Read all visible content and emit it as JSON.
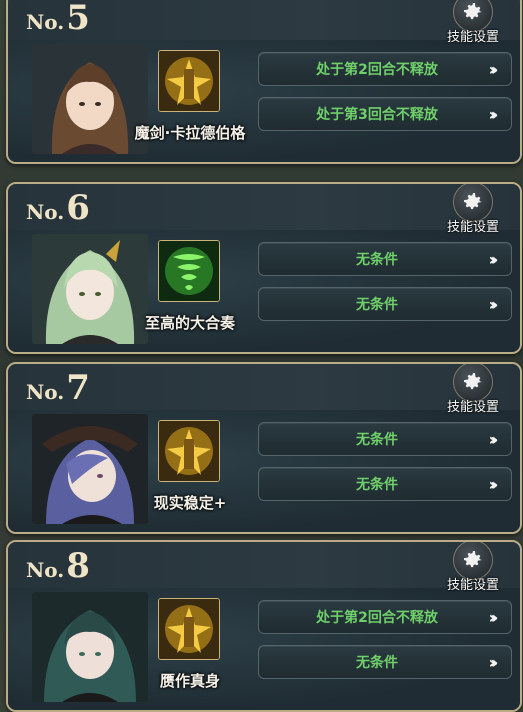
{
  "settings_label": "技能设置",
  "cards": [
    {
      "no_prefix": "No.",
      "number": "5",
      "skill_name": "魔剑·卡拉德伯格",
      "conditions": [
        "处于第2回合不释放",
        "处于第3回合不释放"
      ],
      "skill_color": "#e0a81c",
      "hair_color": "#6b4a32"
    },
    {
      "no_prefix": "No.",
      "number": "6",
      "skill_name": "至高的大合奏",
      "conditions": [
        "无条件",
        "无条件"
      ],
      "skill_color": "#3fc33a",
      "hair_color": "#a7c9a2"
    },
    {
      "no_prefix": "No.",
      "number": "7",
      "skill_name": "现实稳定+",
      "conditions": [
        "无条件",
        "无条件"
      ],
      "skill_color": "#e0a81c",
      "hair_color": "#5a5fa0"
    },
    {
      "no_prefix": "No.",
      "number": "8",
      "skill_name": "赝作真身",
      "conditions": [
        "处于第2回合不释放",
        "无条件"
      ],
      "skill_color": "#e0a81c",
      "hair_color": "#2f5a55"
    }
  ]
}
